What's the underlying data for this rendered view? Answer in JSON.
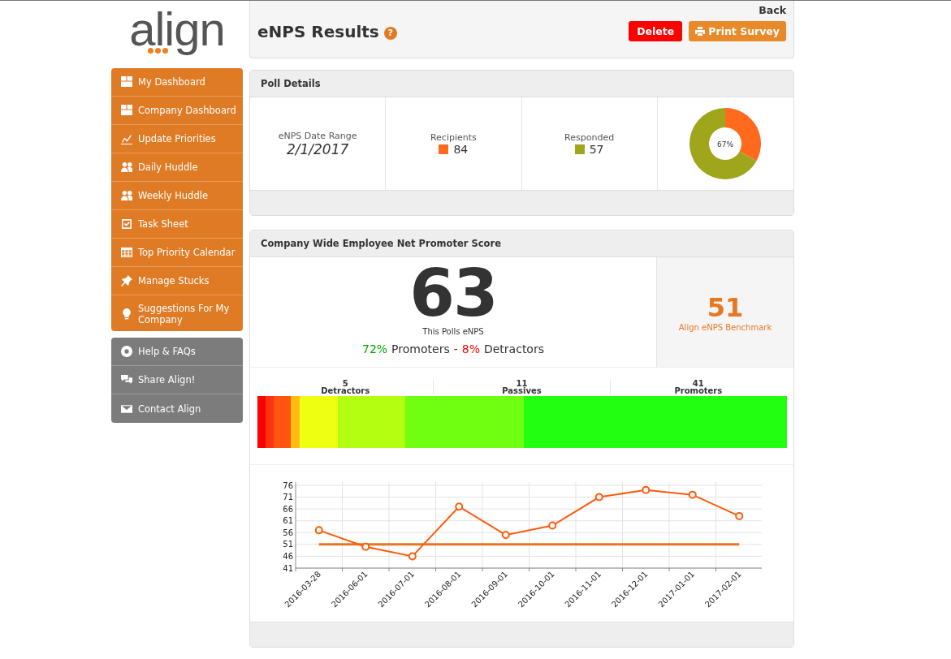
{
  "logo": {
    "text": "align"
  },
  "sidebar": {
    "items": [
      {
        "label": "My Dashboard"
      },
      {
        "label": "Company Dashboard"
      },
      {
        "label": "Update Priorities"
      },
      {
        "label": "Daily Huddle"
      },
      {
        "label": "Weekly Huddle"
      },
      {
        "label": "Task Sheet"
      },
      {
        "label": "Top Priority Calendar"
      },
      {
        "label": "Manage Stucks"
      },
      {
        "label": "Suggestions For My Company"
      }
    ],
    "help_items": [
      {
        "label": "Help & FAQs"
      },
      {
        "label": "Share Align!"
      },
      {
        "label": "Contact Align"
      }
    ]
  },
  "header": {
    "back": "Back",
    "title": "eNPS Results",
    "help": "?",
    "buttons": [
      {
        "label": "Delete",
        "kind": "danger"
      },
      {
        "label": "Print Survey",
        "kind": "print"
      }
    ]
  },
  "poll": {
    "title": "Poll Details",
    "date_label": "eNPS Date Range",
    "date": "2/1/2017",
    "stats": [
      {
        "label": "Recipients",
        "value": "84",
        "color": "#ff6a1f"
      },
      {
        "label": "Responded",
        "value": "57",
        "color": "#9fa61b"
      }
    ],
    "donut_label": "67%",
    "chart_data": {
      "type": "donut",
      "values": [
        33,
        67
      ]
    }
  },
  "score": {
    "title": "Company Wide Employee Net Promoter Score",
    "value": "63",
    "caption": "This Polls eNPS",
    "promoters": "72%",
    "promoters_label": "Promoters",
    "separator": "-",
    "detractors": "8%",
    "detractors_label": "Detractors",
    "benchmark": "51",
    "benchmark_label": "Align eNPS Benchmark"
  },
  "groups": [
    {
      "count": "5",
      "label": "Detractors"
    },
    {
      "count": "11",
      "label": "Passives"
    },
    {
      "count": "41",
      "label": "Promoters"
    }
  ],
  "trend": {
    "chart_data": {
      "type": "line",
      "categories": [
        "2016-03-28",
        "2016-06-01",
        "2016-07-01",
        "2016-08-01",
        "2016-09-01",
        "2016-10-01",
        "2016-11-01",
        "2016-12-01",
        "2017-01-01",
        "2017-02-01"
      ],
      "series": [
        {
          "color": "#e87722",
          "values": [
            51,
            51,
            51,
            51,
            51,
            51,
            51,
            51,
            51,
            51
          ]
        },
        {
          "color": "#ff5a0a",
          "marker": "circle",
          "values": [
            57,
            50,
            46,
            67,
            55,
            59,
            71,
            74,
            72,
            63
          ]
        }
      ],
      "ylim": [
        41,
        76
      ],
      "yticks": [
        41,
        46,
        51,
        56,
        61,
        66,
        71,
        76
      ],
      "grid": true
    }
  }
}
